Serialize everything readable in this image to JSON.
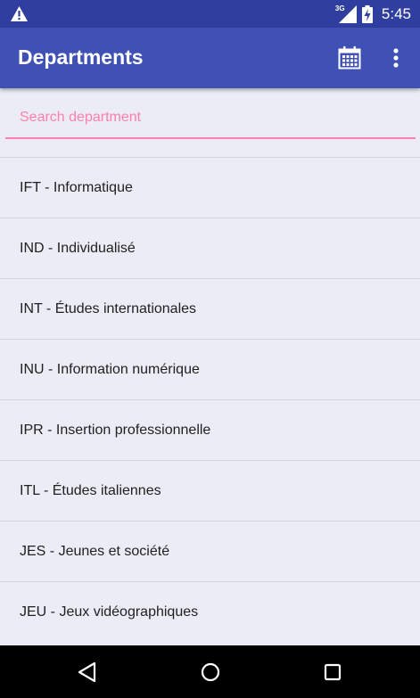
{
  "status_bar": {
    "network_label": "3G",
    "time": "5:45",
    "icons": [
      "warning-icon",
      "signal-icon",
      "battery-charging-icon"
    ]
  },
  "app_bar": {
    "title": "Departments",
    "actions": [
      "calendar-icon",
      "overflow-menu-icon"
    ]
  },
  "search": {
    "placeholder": "Search department",
    "value": ""
  },
  "departments": [
    "IFT - Informatique",
    "IND - Individualisé",
    "INT - Études internationales",
    "INU - Information numérique",
    "IPR - Insertion professionnelle",
    "ITL - Études italiennes",
    "JES - Jeunes et société",
    "JEU - Jeux vidéographiques"
  ],
  "nav_bar": {
    "buttons": [
      "back-icon",
      "home-icon",
      "recents-icon"
    ]
  },
  "colors": {
    "status_bar": "#303F9F",
    "app_bar": "#3F51B5",
    "accent": "#FF80AB",
    "background": "#ECECF6"
  }
}
